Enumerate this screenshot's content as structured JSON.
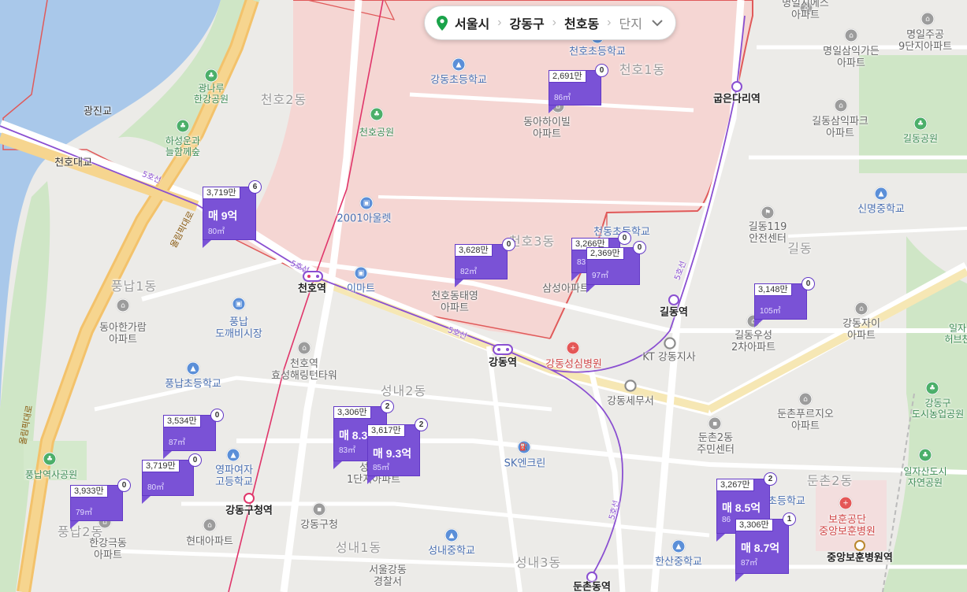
{
  "breadcrumb": {
    "city": "서울시",
    "district": "강동구",
    "dong": "천호동",
    "type": "단지",
    "icons": {
      "pin": "location-pin-icon",
      "chevron": "chevron-down-icon"
    },
    "colors": {
      "pin": "#1aa34a"
    }
  },
  "map_labels": {
    "cheonho1dong": "천호1동",
    "cheonho2dong": "천호2동",
    "cheonho3dong": "천호3동",
    "pungnap1dong": "풍납1동",
    "pungnap2dong": "풍납2동",
    "seongnae1dong": "성내1동",
    "seongnae2dong": "성내2동",
    "seongnae3dong": "성내3동",
    "dunchon2dong": "둔촌2동",
    "gildong": "길동",
    "gwangjingyo": "광진교",
    "cheonhodaegyo": "천호대교",
    "gwangnaru_line1": "광나루",
    "gwangnaru_line2": "한강공원",
    "haseong_line1": "하성운과",
    "haseong_line2": "늘함께숲",
    "olympic_road": "올림픽대로",
    "olympic_road2": "올림픽대로",
    "line5_a": "5호선",
    "line5_b": "5호선",
    "line5_c": "5호선",
    "line5_d": "5호선",
    "line5_e": "5호선",
    "cheonho_elem": "천호초등학교",
    "gangdong_elem": "강동초등학교",
    "cheonho_park": "천호공원",
    "donga_line1": "동아하이빌",
    "donga_line2": "아파트",
    "outlet": "2001아울렛",
    "emart": "이마트",
    "cheonhodongtaeyoung_line1": "천호동태영",
    "cheonhodongtaeyoung_line2": "아파트",
    "samsung": "삼성아파트",
    "cheonho_elem2": "천동초등학교",
    "myeongil_line1": "명일지에스",
    "myeongil_line2": "아파트",
    "myeongilsamik_line1": "명일삼익가든",
    "myeongilsamik_line2": "아파트",
    "myeongiljugong_line1": "명일주공",
    "myeongiljugong_line2": "9단지아파트",
    "gildongsamik_line1": "길동삼익파크",
    "gildongsamik_line2": "아파트",
    "gildong_park": "길동공원",
    "sinmyeong": "신명중학교",
    "gildong119_line1": "길동119",
    "gildong119_line2": "안전센터",
    "gangdongjai_line1": "강동자이",
    "gangdongjai_line2": "아파트",
    "gildongwoosung_line1": "길동우성",
    "gildongwoosung_line2": "2차아파트",
    "kt": "KT 강동지사",
    "hospital": "강동성심병원",
    "tax": "강동세무서",
    "dunchon_purgio_line1": "둔촌푸르지오",
    "dunchon_purgio_line2": "아파트",
    "dunchon_center_line1": "둔촌2동",
    "dunchon_center_line2": "주민센터",
    "sk": "SK엔크린",
    "donga_hangaram_line1": "동아한가람",
    "donga_hangaram_line2": "아파트",
    "pungnap_market_line1": "풍납",
    "pungnap_market_line2": "도깨비시장",
    "cheonho_tower_line1": "천호역",
    "cheonho_tower_line2": "효성해링턴타워",
    "pungnap_elem": "풍납초등학교",
    "pungnap_park": "풍납역사공원",
    "girls_high_line1": "영파여자",
    "girls_high_line2": "고등학교",
    "hangang_line1": "한강극동",
    "hangang_line2": "아파트",
    "hyundai": "현대아파트",
    "gangdong_office": "강동구청",
    "seongnae_mid": "성내중학교",
    "seoul_gangdong_police_line1": "서울강동",
    "seoul_gangdong_police_line2": "경찰서",
    "hansan_mid": "한산중학교",
    "dunchon_elem": "동초등학교",
    "bohun_line1": "보훈공단",
    "bohun_line2": "중앙보훈병원",
    "farm_line1": "강동구",
    "farm_line2": "도시농업공원",
    "ilja_line1": "일자산도시",
    "ilja_line2": "자연공원",
    "ilja_herb_line1": "일자",
    "ilja_herb_line2": "허브천",
    "seongnae_apt_line1": "성내동",
    "seongnae_apt_line2": "1단지아파트"
  },
  "stations": {
    "cheonho": "천호역",
    "gangdong": "강동역",
    "gildong": "길동역",
    "gubeundari": "굽은다리역",
    "gangdonggucheong": "강동구청역",
    "dunchondong": "둔촌동역",
    "bohun_station": "중앙보훈병원역"
  },
  "markers": [
    {
      "price": "3,719만",
      "count": "6",
      "sale": "매 9억",
      "area": "80㎡",
      "big": true
    },
    {
      "price": "2,691만",
      "count": "0",
      "sale": "",
      "area": "86㎡",
      "big": false
    },
    {
      "price": "3,628만",
      "count": "0",
      "sale": "",
      "area": "82㎡",
      "big": false
    },
    {
      "price": "3,266만",
      "count": "0",
      "sale": "",
      "area": "83",
      "big": false
    },
    {
      "price": "2,369만",
      "count": "0",
      "sale": "",
      "area": "97㎡",
      "big": false
    },
    {
      "price": "3,148만",
      "count": "0",
      "sale": "",
      "area": "105㎡",
      "big": false
    },
    {
      "price": "3,534만",
      "count": "0",
      "sale": "",
      "area": "87㎡",
      "big": false
    },
    {
      "price": "3,719만",
      "count": "0",
      "sale": "",
      "area": "80㎡",
      "big": false
    },
    {
      "price": "3,933만",
      "count": "0",
      "sale": "",
      "area": "79㎡",
      "big": false
    },
    {
      "price": "3,306만",
      "count": "2",
      "sale": "매 8.3",
      "area": "83㎡",
      "big": true
    },
    {
      "price": "3,617만",
      "count": "2",
      "sale": "매 9.3억",
      "area": "85㎡",
      "big": true
    },
    {
      "price": "3,267만",
      "count": "2",
      "sale": "매 8.5억",
      "area": "86",
      "big": true
    },
    {
      "price": "3,306만",
      "count": "1",
      "sale": "매 8.7억",
      "area": "87㎡",
      "big": true
    }
  ],
  "colors": {
    "marker": "#7a52d6",
    "line5": "#8a4fd1",
    "line8": "#e0356a",
    "river": "#a9c8ea",
    "highlight_fill": "#f4c9c6",
    "highlight_border": "#e05a5a"
  }
}
